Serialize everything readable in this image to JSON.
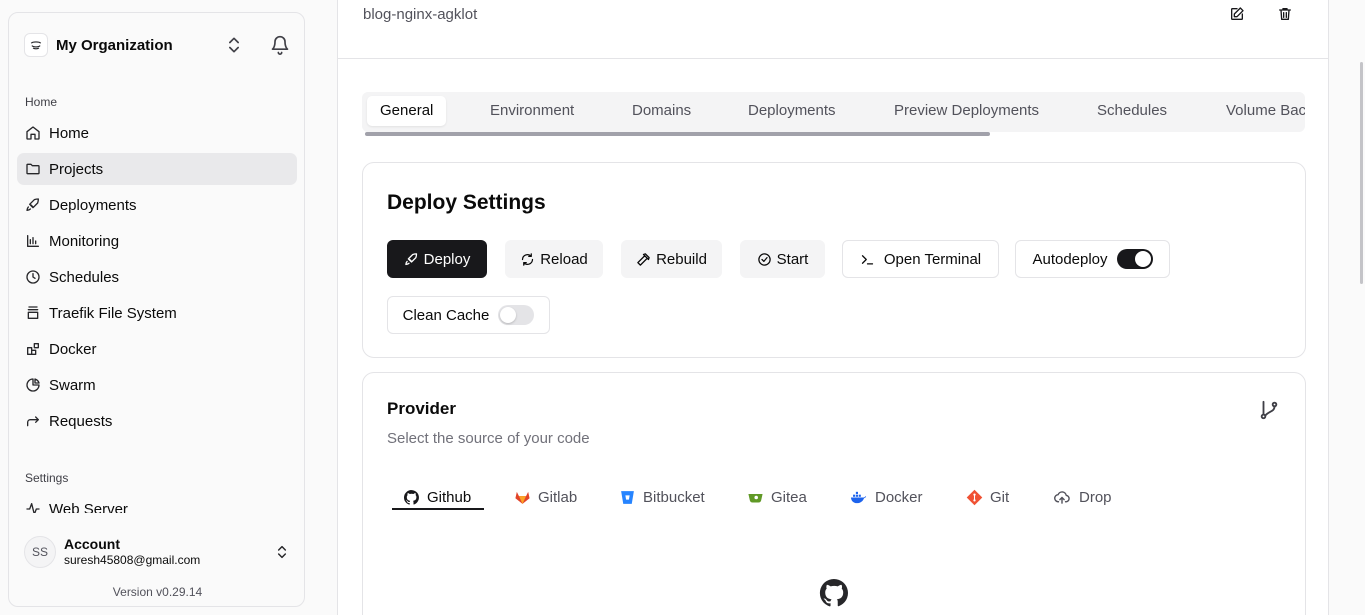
{
  "sidebar": {
    "org_name": "My Organization",
    "home_label": "Home",
    "settings_label": "Settings",
    "items": [
      {
        "label": "Home",
        "icon": "home-icon"
      },
      {
        "label": "Projects",
        "icon": "folder-icon"
      },
      {
        "label": "Deployments",
        "icon": "rocket-icon"
      },
      {
        "label": "Monitoring",
        "icon": "chart-icon"
      },
      {
        "label": "Schedules",
        "icon": "clock-icon"
      },
      {
        "label": "Traefik File System",
        "icon": "server-icon"
      },
      {
        "label": "Docker",
        "icon": "blocks-icon"
      },
      {
        "label": "Swarm",
        "icon": "pie-icon"
      },
      {
        "label": "Requests",
        "icon": "arrow-icon"
      }
    ],
    "settings_items": [
      {
        "label": "Web Server",
        "icon": "activity-icon"
      }
    ],
    "account": {
      "initials": "SS",
      "name": "Account",
      "email": "suresh45808@gmail.com"
    },
    "version": "Version v0.29.14"
  },
  "main": {
    "app_name": "blog-nginx-agklot",
    "tabs": [
      "General",
      "Environment",
      "Domains",
      "Deployments",
      "Preview Deployments",
      "Schedules",
      "Volume Bac"
    ],
    "deploy": {
      "title": "Deploy Settings",
      "deploy": "Deploy",
      "reload": "Reload",
      "rebuild": "Rebuild",
      "start": "Start",
      "terminal": "Open Terminal",
      "autodeploy": "Autodeploy",
      "clean_cache": "Clean Cache"
    },
    "provider": {
      "title": "Provider",
      "subtitle": "Select the source of your code",
      "tabs": [
        "Github",
        "Gitlab",
        "Bitbucket",
        "Gitea",
        "Docker",
        "Git",
        "Drop"
      ]
    }
  },
  "colors": {
    "accent": "#18181b",
    "gitlab": "#e24329",
    "bitbucket": "#2684ff",
    "gitea": "#609926",
    "docker": "#1d63ed",
    "git": "#f05133"
  }
}
